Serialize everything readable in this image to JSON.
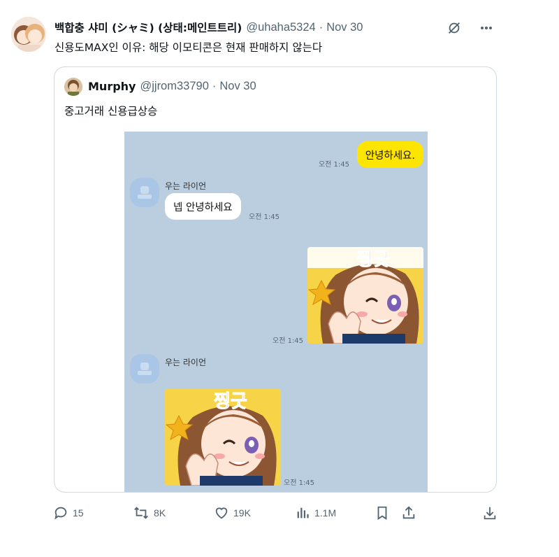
{
  "author": {
    "display_name": "백합충 샤미 (シャミ) (상태:메인트트리)",
    "handle": "@uhaha5324",
    "separator": "·",
    "date": "Nov 30"
  },
  "text": "신용도MAX인 이유: 해당 이모티콘은 현재 판매하지 않는다",
  "quote": {
    "display_name": "Murphy",
    "handle": "@jjrom33790",
    "separator": "·",
    "date": "Nov 30",
    "text": "중고거래 신용급상승",
    "chat": {
      "messages": [
        {
          "from": "me",
          "text": "안녕하세요.",
          "time": "오전 1:45"
        },
        {
          "from": "friend",
          "sender": "우는 라이언",
          "text": "넵 안녕하세요",
          "time": "오전 1:45"
        },
        {
          "from": "me",
          "sticker": "sticker-wink-thumbsup",
          "sticker_text": "찡긋",
          "time": "오전 1:45"
        },
        {
          "from": "friend",
          "sender": "우는 라이언",
          "sticker": "sticker-wink-thumbsup",
          "sticker_text": "찡긋",
          "time": "오전 1:45"
        }
      ],
      "colors": {
        "background": "#bacee0",
        "my_bubble": "#fee500",
        "friend_bubble": "#ffffff"
      }
    }
  },
  "actions": {
    "reply": {
      "icon": "reply-icon",
      "count": "15"
    },
    "retweet": {
      "icon": "retweet-icon",
      "count": "8K"
    },
    "like": {
      "icon": "heart-icon",
      "count": "19K"
    },
    "views": {
      "icon": "views-icon",
      "count": "1.1M"
    },
    "bookmark": {
      "icon": "bookmark-icon"
    },
    "share": {
      "icon": "share-icon"
    },
    "download": {
      "icon": "download-icon"
    }
  },
  "colors": {
    "text": "#0f1419",
    "secondary": "#536471",
    "border": "#cfd9de"
  }
}
